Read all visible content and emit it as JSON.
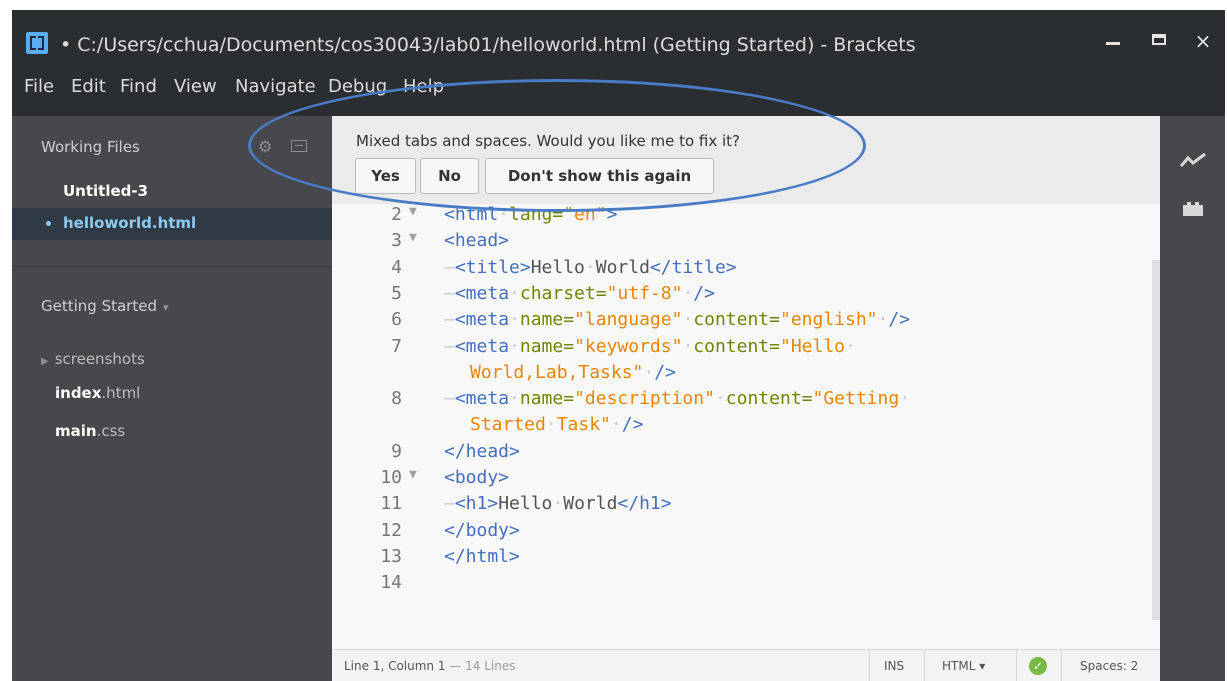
{
  "window": {
    "title": "• C:/Users/cchua/Documents/cos30043/lab01/helloworld.html (Getting Started) - Brackets",
    "controls": {
      "minimize": "minimize",
      "maximize": "maximize",
      "close": "×"
    }
  },
  "menu": [
    "File",
    "Edit",
    "Find",
    "View",
    "Navigate",
    "Debug",
    "Help"
  ],
  "sidebar": {
    "working_files_title": "Working Files",
    "working_files": [
      {
        "name": "Untitled-3",
        "active": false
      },
      {
        "name": "helloworld.html",
        "active": true
      }
    ],
    "project_title": "Getting Started",
    "project_arrow": "▾",
    "tree": [
      {
        "name": "screenshots",
        "ext": "",
        "folder": true
      },
      {
        "name": "index",
        "ext": ".html",
        "folder": false
      },
      {
        "name": "main",
        "ext": ".css",
        "folder": false
      }
    ]
  },
  "infobar": {
    "message": "Mixed tabs and spaces. Would you like me to fix it?",
    "buttons": {
      "yes": "Yes",
      "no": "No",
      "dont_show": "Don't show this again"
    }
  },
  "editor": {
    "lines": [
      {
        "n": "2",
        "fold": true,
        "indent": false,
        "parts": [
          [
            "tag",
            "<html"
          ],
          [
            "ws",
            "·"
          ],
          [
            "attr",
            "lang="
          ],
          [
            "str",
            "\"en\""
          ],
          [
            "tag",
            ">"
          ]
        ]
      },
      {
        "n": "3",
        "fold": true,
        "indent": false,
        "parts": [
          [
            "tag",
            "<head>"
          ]
        ]
      },
      {
        "n": "4",
        "fold": false,
        "indent": true,
        "parts": [
          [
            "tag",
            "<title>"
          ],
          [
            "txt",
            "Hello"
          ],
          [
            "ws",
            "·"
          ],
          [
            "txt",
            "World"
          ],
          [
            "tag",
            "</title>"
          ]
        ]
      },
      {
        "n": "5",
        "fold": false,
        "indent": true,
        "parts": [
          [
            "tag",
            "<meta"
          ],
          [
            "ws",
            "·"
          ],
          [
            "attr",
            "charset="
          ],
          [
            "str",
            "\"utf-8\""
          ],
          [
            "ws",
            "·"
          ],
          [
            "tag",
            "/>"
          ]
        ]
      },
      {
        "n": "6",
        "fold": false,
        "indent": true,
        "parts": [
          [
            "tag",
            "<meta"
          ],
          [
            "ws",
            "·"
          ],
          [
            "attr",
            "name="
          ],
          [
            "str",
            "\"language\""
          ],
          [
            "ws",
            "·"
          ],
          [
            "attr",
            "content="
          ],
          [
            "str",
            "\"english\""
          ],
          [
            "ws",
            "·"
          ],
          [
            "tag",
            "/>"
          ]
        ]
      },
      {
        "n": "7",
        "fold": false,
        "indent": true,
        "parts": [
          [
            "tag",
            "<meta"
          ],
          [
            "ws",
            "·"
          ],
          [
            "attr",
            "name="
          ],
          [
            "str",
            "\"keywords\""
          ],
          [
            "ws",
            "·"
          ],
          [
            "attr",
            "content="
          ],
          [
            "str",
            "\"Hello"
          ],
          [
            "ws",
            "·"
          ]
        ]
      },
      {
        "n": "",
        "fold": false,
        "indent": false,
        "wrap": true,
        "parts": [
          [
            "str",
            "World,Lab,Tasks\""
          ],
          [
            "ws",
            "·"
          ],
          [
            "tag",
            "/>"
          ]
        ]
      },
      {
        "n": "8",
        "fold": false,
        "indent": true,
        "parts": [
          [
            "tag",
            "<meta"
          ],
          [
            "ws",
            "·"
          ],
          [
            "attr",
            "name="
          ],
          [
            "str",
            "\"description\""
          ],
          [
            "ws",
            "·"
          ],
          [
            "attr",
            "content="
          ],
          [
            "str",
            "\"Getting"
          ],
          [
            "ws",
            "·"
          ]
        ]
      },
      {
        "n": "",
        "fold": false,
        "indent": false,
        "wrap": true,
        "parts": [
          [
            "str",
            "Started"
          ],
          [
            "ws",
            "·"
          ],
          [
            "str",
            "Task\""
          ],
          [
            "ws",
            "·"
          ],
          [
            "tag",
            "/>"
          ]
        ]
      },
      {
        "n": "9",
        "fold": false,
        "indent": false,
        "parts": [
          [
            "tag",
            "</head>"
          ]
        ]
      },
      {
        "n": "10",
        "fold": true,
        "indent": false,
        "parts": [
          [
            "tag",
            "<body>"
          ]
        ]
      },
      {
        "n": "11",
        "fold": false,
        "indent": true,
        "parts": [
          [
            "tag",
            "<h1>"
          ],
          [
            "txt",
            "Hello"
          ],
          [
            "ws",
            "·"
          ],
          [
            "txt",
            "World"
          ],
          [
            "tag",
            "</h1>"
          ]
        ]
      },
      {
        "n": "12",
        "fold": false,
        "indent": false,
        "parts": [
          [
            "tag",
            "</body>"
          ]
        ]
      },
      {
        "n": "13",
        "fold": false,
        "indent": false,
        "parts": [
          [
            "tag",
            "</html>"
          ]
        ]
      },
      {
        "n": "14",
        "fold": false,
        "indent": false,
        "parts": []
      }
    ]
  },
  "statusbar": {
    "position": "Line 1, Column 1",
    "line_count": " — 14 Lines",
    "mode": "INS",
    "language": "HTML ▾",
    "spaces": "Spaces: 2"
  },
  "colors": {
    "accent": "#8fcaf3",
    "annotation": "#4a7bc6",
    "ok": "#78b846"
  }
}
